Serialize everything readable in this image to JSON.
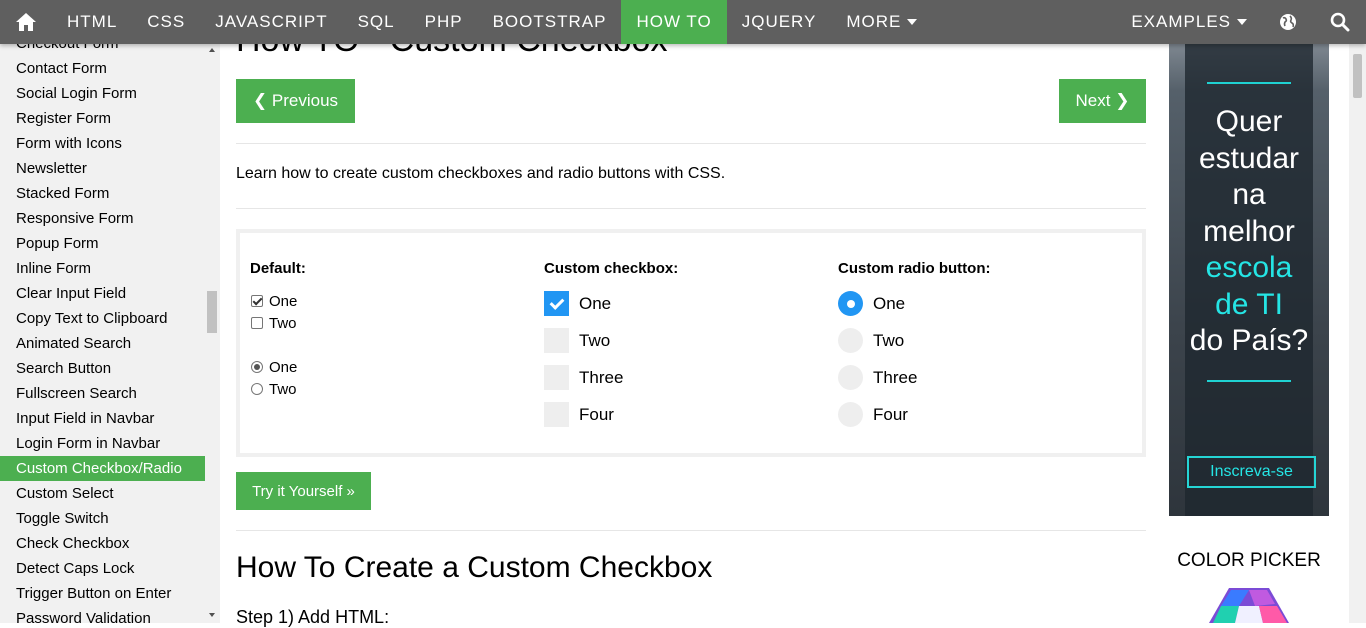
{
  "topnav": {
    "items": [
      {
        "label": "HTML",
        "active": false
      },
      {
        "label": "CSS",
        "active": false
      },
      {
        "label": "JAVASCRIPT",
        "active": false
      },
      {
        "label": "SQL",
        "active": false
      },
      {
        "label": "PHP",
        "active": false
      },
      {
        "label": "BOOTSTRAP",
        "active": false
      },
      {
        "label": "HOW TO",
        "active": true
      },
      {
        "label": "JQUERY",
        "active": false
      },
      {
        "label": "MORE",
        "active": false
      }
    ],
    "examples_label": "EXAMPLES",
    "active_color": "#4CAF50",
    "bar_color": "#5f5f5f"
  },
  "sidebar": {
    "items": [
      {
        "label": "Checkout Form"
      },
      {
        "label": "Contact Form"
      },
      {
        "label": "Social Login Form"
      },
      {
        "label": "Register Form"
      },
      {
        "label": "Form with Icons"
      },
      {
        "label": "Newsletter"
      },
      {
        "label": "Stacked Form"
      },
      {
        "label": "Responsive Form"
      },
      {
        "label": "Popup Form"
      },
      {
        "label": "Inline Form"
      },
      {
        "label": "Clear Input Field"
      },
      {
        "label": "Copy Text to Clipboard"
      },
      {
        "label": "Animated Search"
      },
      {
        "label": "Search Button"
      },
      {
        "label": "Fullscreen Search"
      },
      {
        "label": "Input Field in Navbar"
      },
      {
        "label": "Login Form in Navbar"
      },
      {
        "label": "Custom Checkbox/Radio",
        "active": true
      },
      {
        "label": "Custom Select"
      },
      {
        "label": "Toggle Switch"
      },
      {
        "label": "Check Checkbox"
      },
      {
        "label": "Detect Caps Lock"
      },
      {
        "label": "Trigger Button on Enter"
      },
      {
        "label": "Password Validation"
      }
    ]
  },
  "main": {
    "title": "How TO - Custom Checkbox",
    "prev_label": "❮ Previous",
    "next_label": "Next ❯",
    "intro": "Learn how to create custom checkboxes and radio buttons with CSS.",
    "demo": {
      "default_title": "Default:",
      "default_checkboxes": [
        {
          "label": "One",
          "checked": true
        },
        {
          "label": "Two",
          "checked": false
        }
      ],
      "default_radios": [
        {
          "label": "One",
          "checked": true
        },
        {
          "label": "Two",
          "checked": false
        }
      ],
      "custom_checkbox_title": "Custom checkbox:",
      "custom_checkboxes": [
        {
          "label": "One",
          "checked": true
        },
        {
          "label": "Two",
          "checked": false
        },
        {
          "label": "Three",
          "checked": false
        },
        {
          "label": "Four",
          "checked": false
        }
      ],
      "custom_radio_title": "Custom radio button:",
      "custom_radios": [
        {
          "label": "One",
          "checked": true
        },
        {
          "label": "Two",
          "checked": false
        },
        {
          "label": "Three",
          "checked": false
        },
        {
          "label": "Four",
          "checked": false
        }
      ],
      "accent_color": "#2196F3"
    },
    "try_label": "Try it Yourself »",
    "section_heading": "How To Create a Custom Checkbox",
    "step_label": "Step 1) Add HTML:"
  },
  "ad": {
    "lines": [
      "Quer",
      "estudar",
      "na",
      "melhor"
    ],
    "highlight_lines": [
      "escola",
      "de TI"
    ],
    "tail_line": "do País?",
    "cta_label": "Inscreva-se",
    "accent_color": "#25e5e5"
  },
  "color_picker": {
    "title": "COLOR PICKER"
  }
}
